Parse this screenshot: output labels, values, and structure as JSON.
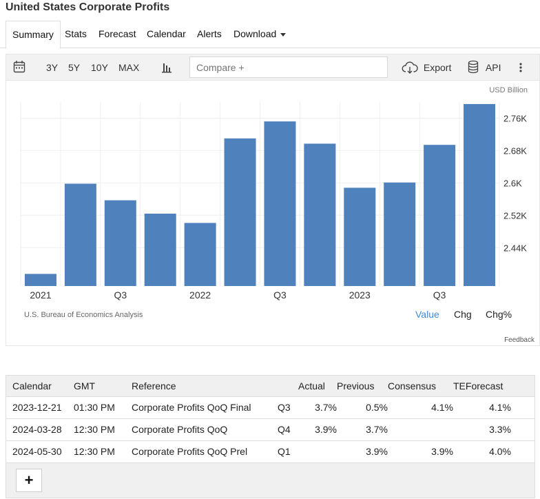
{
  "page": {
    "title": "United States Corporate Profits"
  },
  "tabs": [
    {
      "label": "Summary"
    },
    {
      "label": "Stats"
    },
    {
      "label": "Forecast"
    },
    {
      "label": "Calendar"
    },
    {
      "label": "Alerts"
    },
    {
      "label": "Download"
    }
  ],
  "toolbar": {
    "ranges": [
      "3Y",
      "5Y",
      "10Y",
      "MAX"
    ],
    "compare_placeholder": "Compare +",
    "export_label": "Export",
    "api_label": "API"
  },
  "chart": {
    "unit": "USD Billion",
    "source": "U.S. Bureau of Economics Analysis",
    "modes": [
      "Value",
      "Chg",
      "Chg%"
    ],
    "active_mode": "Value",
    "feedback": "Feedback",
    "bar_color": "#4f81bd"
  },
  "chart_data": {
    "type": "bar",
    "categories": [
      "2021 Q1",
      "2021 Q2",
      "2021 Q3",
      "2021 Q4",
      "2022 Q1",
      "2022 Q2",
      "2022 Q3",
      "2022 Q4",
      "2023 Q1",
      "2023 Q2",
      "2023 Q3",
      "2023 Q4"
    ],
    "x_tick_labels": [
      "2021",
      "",
      "Q3",
      "",
      "2022",
      "",
      "Q3",
      "",
      "2023",
      "",
      "Q3",
      ""
    ],
    "values": [
      2.375,
      2.598,
      2.557,
      2.524,
      2.501,
      2.71,
      2.752,
      2.697,
      2.588,
      2.601,
      2.694,
      2.795
    ],
    "ylabel": "USD Billion",
    "y_ticks": [
      "2.44K",
      "2.52K",
      "2.6K",
      "2.68K",
      "2.76K"
    ],
    "y_tick_values": [
      2.44,
      2.52,
      2.6,
      2.68,
      2.76
    ],
    "ylim": [
      2.345,
      2.8
    ],
    "grid": true
  },
  "calendar": {
    "headers": [
      "Calendar",
      "GMT",
      "Reference",
      "",
      "Actual",
      "Previous",
      "Consensus",
      "TEForecast"
    ],
    "rows": [
      [
        "2023-12-21",
        "01:30 PM",
        "Corporate Profits QoQ Final",
        "Q3",
        "3.7%",
        "0.5%",
        "4.1%",
        "4.1%"
      ],
      [
        "2024-03-28",
        "12:30 PM",
        "Corporate Profits QoQ",
        "Q4",
        "3.9%",
        "3.7%",
        "",
        "3.3%"
      ],
      [
        "2024-05-30",
        "12:30 PM",
        "Corporate Profits QoQ Prel",
        "Q1",
        "",
        "3.9%",
        "3.9%",
        "4.0%"
      ]
    ],
    "add_label": "+"
  },
  "icons": {
    "calendar": "calendar-icon",
    "chart_type": "bar-chart-icon",
    "export": "cloud-download-icon",
    "api": "database-icon",
    "more": "more-vertical-icon"
  }
}
